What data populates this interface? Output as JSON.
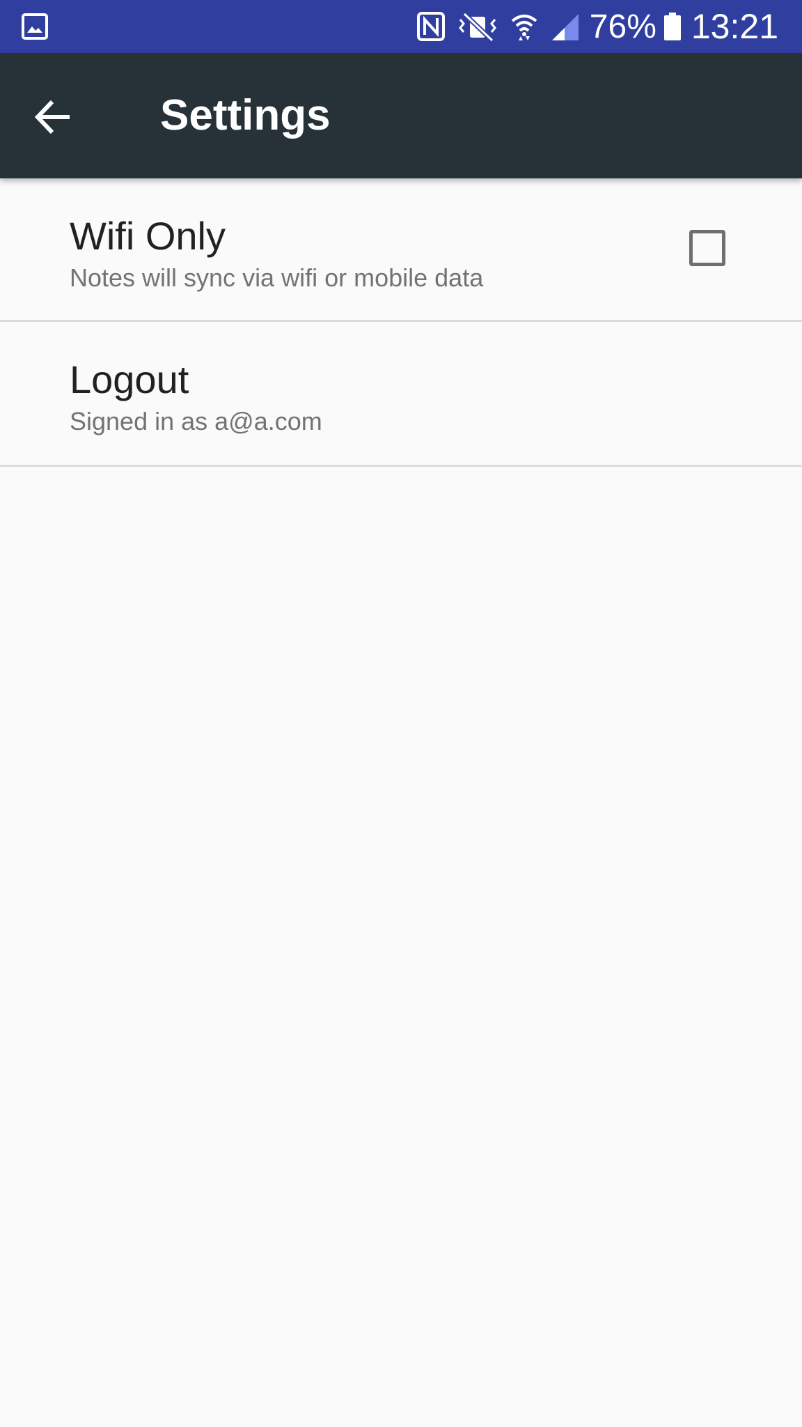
{
  "status_bar": {
    "icons": [
      "gallery-notification-icon",
      "nfc-icon",
      "vibrate-mute-icon",
      "wifi-icon",
      "cell-signal-icon",
      "battery-icon"
    ],
    "battery_percent": "76%",
    "time": "13:21",
    "background_color": "#303f9f"
  },
  "app_bar": {
    "title": "Settings",
    "back_icon": "arrow-back-icon",
    "background_color": "#263238"
  },
  "settings": {
    "items": [
      {
        "title": "Wifi Only",
        "summary": "Notes will sync via wifi or mobile data",
        "checked": false
      },
      {
        "title": "Logout",
        "summary": "Signed in as a@a.com"
      }
    ]
  }
}
